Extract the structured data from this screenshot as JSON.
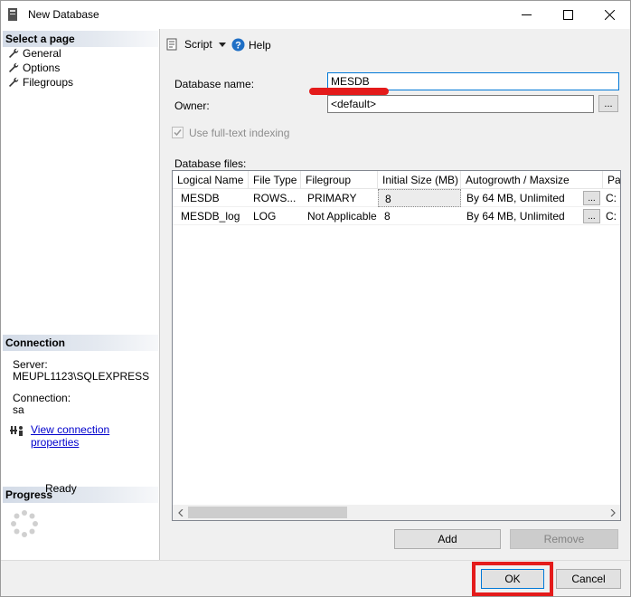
{
  "window": {
    "title": "New Database",
    "icon": "database-icon"
  },
  "select_page": {
    "header": "Select a page",
    "items": [
      {
        "label": "General",
        "icon": "wrench-icon"
      },
      {
        "label": "Options",
        "icon": "wrench-icon"
      },
      {
        "label": "Filegroups",
        "icon": "wrench-icon"
      }
    ]
  },
  "connection": {
    "header": "Connection",
    "server_label": "Server:",
    "server_value": "MEUPL1123\\SQLEXPRESS",
    "connection_label": "Connection:",
    "connection_value": "sa",
    "link": "View connection properties"
  },
  "progress": {
    "header": "Progress",
    "status": "Ready"
  },
  "toolbar": {
    "script_label": "Script",
    "help_label": "Help"
  },
  "form": {
    "db_name_label": "Database name:",
    "db_name_value": "MESDB",
    "owner_label": "Owner:",
    "owner_value": "<default>",
    "browse_label": "...",
    "fulltext_label": "Use full-text indexing",
    "fulltext_checked": true,
    "db_files_label": "Database files:"
  },
  "grid": {
    "columns": [
      "Logical Name",
      "File Type",
      "Filegroup",
      "Initial Size (MB)",
      "Autogrowth / Maxsize",
      "Pa"
    ],
    "rows": [
      {
        "logical": "MESDB",
        "type": "ROWS...",
        "filegroup": "PRIMARY",
        "size": "8",
        "autogrowth": "By 64 MB, Unlimited",
        "ellipsis": "...",
        "path": "C:"
      },
      {
        "logical": "MESDB_log",
        "type": "LOG",
        "filegroup": "Not Applicable",
        "size": "8",
        "autogrowth": "By 64 MB, Unlimited",
        "ellipsis": "...",
        "path": "C:"
      }
    ]
  },
  "buttons": {
    "add": "Add",
    "remove": "Remove",
    "ok": "OK",
    "cancel": "Cancel"
  },
  "colors": {
    "annotation": "#e41b1b",
    "link": "#0000cc",
    "focus": "#0078d7"
  }
}
